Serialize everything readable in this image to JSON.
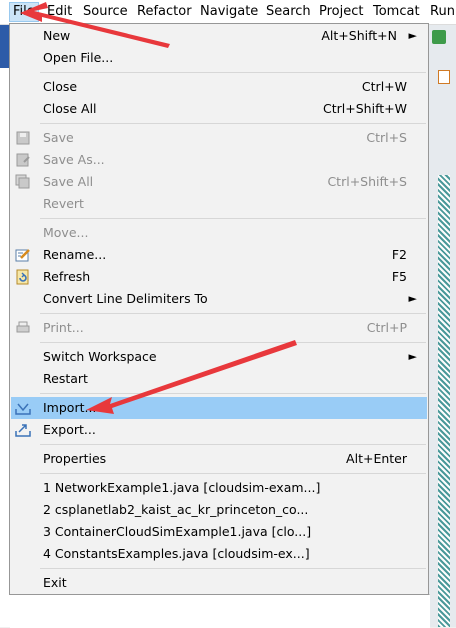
{
  "menubar": {
    "items": [
      "File",
      "Edit",
      "Source",
      "Refactor",
      "Navigate",
      "Search",
      "Project",
      "Tomcat",
      "Run"
    ]
  },
  "file_menu": {
    "new": {
      "label": "New",
      "shortcut": "Alt+Shift+N"
    },
    "open_file": {
      "label": "Open File..."
    },
    "close": {
      "label": "Close",
      "shortcut": "Ctrl+W"
    },
    "close_all": {
      "label": "Close All",
      "shortcut": "Ctrl+Shift+W"
    },
    "save": {
      "label": "Save",
      "shortcut": "Ctrl+S"
    },
    "save_as": {
      "label": "Save As..."
    },
    "save_all": {
      "label": "Save All",
      "shortcut": "Ctrl+Shift+S"
    },
    "revert": {
      "label": "Revert"
    },
    "move": {
      "label": "Move..."
    },
    "rename": {
      "label": "Rename...",
      "shortcut": "F2"
    },
    "refresh": {
      "label": "Refresh",
      "shortcut": "F5"
    },
    "convert": {
      "label": "Convert Line Delimiters To"
    },
    "print": {
      "label": "Print...",
      "shortcut": "Ctrl+P"
    },
    "switch_workspace": {
      "label": "Switch Workspace"
    },
    "restart": {
      "label": "Restart"
    },
    "import": {
      "label": "Import..."
    },
    "export": {
      "label": "Export..."
    },
    "properties": {
      "label": "Properties",
      "shortcut": "Alt+Enter"
    },
    "recent": [
      "1 NetworkExample1.java  [cloudsim-exam...]",
      "2 csplanetlab2_kaist_ac_kr_princeton_co...",
      "3 ContainerCloudSimExample1.java  [clo...]",
      "4 ConstantsExamples.java  [cloudsim-ex...]"
    ],
    "exit": {
      "label": "Exit"
    }
  },
  "colors": {
    "highlight": "#99ccf6",
    "annotation_arrow": "#e8383c"
  }
}
